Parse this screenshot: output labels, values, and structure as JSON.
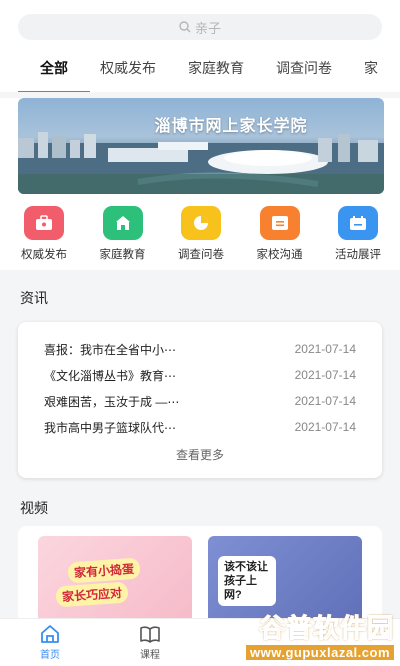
{
  "search": {
    "placeholder": "亲子"
  },
  "tabs": [
    {
      "label": "全部",
      "active": true
    },
    {
      "label": "权威发布"
    },
    {
      "label": "家庭教育"
    },
    {
      "label": "调查问卷"
    },
    {
      "label": "家"
    }
  ],
  "banner": {
    "title": "淄博市网上家长学院"
  },
  "quick_actions": [
    {
      "label": "权威发布",
      "icon": "briefcase-icon",
      "color": "#f25d6b"
    },
    {
      "label": "家庭教育",
      "icon": "home-icon",
      "color": "#2cc07a"
    },
    {
      "label": "调查问卷",
      "icon": "pie-chart-icon",
      "color": "#f7c21c"
    },
    {
      "label": "家校沟通",
      "icon": "message-icon",
      "color": "#f7812f"
    },
    {
      "label": "活动展评",
      "icon": "calendar-icon",
      "color": "#3a95f0"
    }
  ],
  "news": {
    "section_title": "资讯",
    "items": [
      {
        "title": "喜报：我市在全省中小⋯",
        "date": "2021-07-14"
      },
      {
        "title": "《文化淄博丛书》教育⋯",
        "date": "2021-07-14"
      },
      {
        "title": "艰难困苦，玉汝于成 —⋯",
        "date": "2021-07-14"
      },
      {
        "title": "我市高中男子篮球队代⋯",
        "date": "2021-07-14"
      }
    ],
    "more_label": "查看更多"
  },
  "video": {
    "section_title": "视频",
    "thumb1_line1": "家有小捣蛋",
    "thumb1_line2": "家长巧应对",
    "thumb2_text": "该不该让孩子上网?"
  },
  "tabbar": [
    {
      "label": "首页",
      "icon": "home-icon",
      "active": true
    },
    {
      "label": "课程",
      "icon": "book-icon"
    }
  ],
  "watermark": {
    "main": "谷普软件园",
    "url": "www.gupuxlazal.com"
  },
  "colors": {
    "accent": "#3a8df0"
  }
}
